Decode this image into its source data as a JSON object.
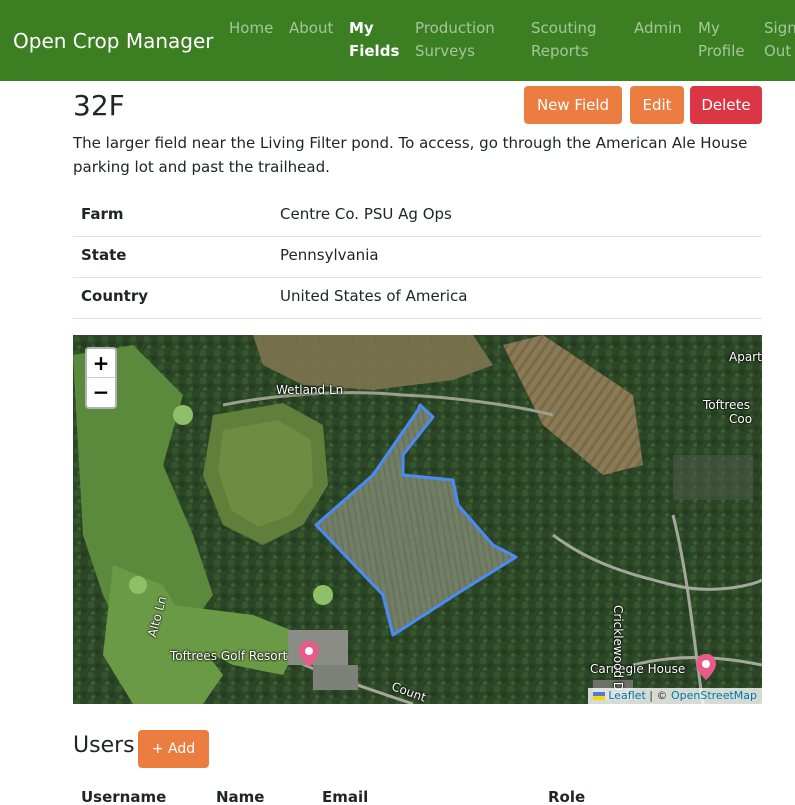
{
  "navbar": {
    "brand": "Open Crop Manager",
    "items": [
      {
        "line1": "Home",
        "line2": ""
      },
      {
        "line1": "About",
        "line2": ""
      },
      {
        "line1": "My",
        "line2": "Fields"
      },
      {
        "line1": "Production",
        "line2": "Surveys"
      },
      {
        "line1": "Scouting",
        "line2": "Reports"
      },
      {
        "line1": "Admin",
        "line2": ""
      },
      {
        "line1": "My",
        "line2": "Profile"
      },
      {
        "line1": "Sign",
        "line2": "Out"
      }
    ],
    "active_item": "My Fields",
    "colors": {
      "background": "#3b7f22"
    }
  },
  "field": {
    "title": "32F",
    "description": "The larger field near the Living Filter pond. To access, go through the American Ale House parking lot and past the trailhead.",
    "details": [
      {
        "label": "Farm",
        "value": "Centre Co. PSU Ag Ops"
      },
      {
        "label": "State",
        "value": "Pennsylvania"
      },
      {
        "label": "Country",
        "value": "United States of America"
      }
    ]
  },
  "actions": {
    "new_field": "New Field",
    "edit": "Edit",
    "delete": "Delete",
    "colors": {
      "primary": "#ea7d3f",
      "danger": "#dc3545"
    }
  },
  "map": {
    "zoom_in": "+",
    "zoom_out": "−",
    "labels": {
      "wetland_ln": "Wetland Ln",
      "apart": "Apart",
      "toftrees_line1": "Toftrees",
      "toftrees_line2": "Coo",
      "toftrees_golf_resort": "Toftrees Golf Resort",
      "carnegie_house": "Carnegie House",
      "cricklewood_dr": "Cricklewood Dr",
      "alto_ln": "Alto Ln",
      "country": "Count"
    },
    "attribution": {
      "leaflet": "Leaflet",
      "separator": " | © ",
      "osm": "OpenStreetMap"
    },
    "field_outline_color": "#4a8cf7"
  },
  "users": {
    "title": "Users",
    "add_button": "+ Add",
    "columns": [
      "Username",
      "Name",
      "Email",
      "Role"
    ]
  }
}
